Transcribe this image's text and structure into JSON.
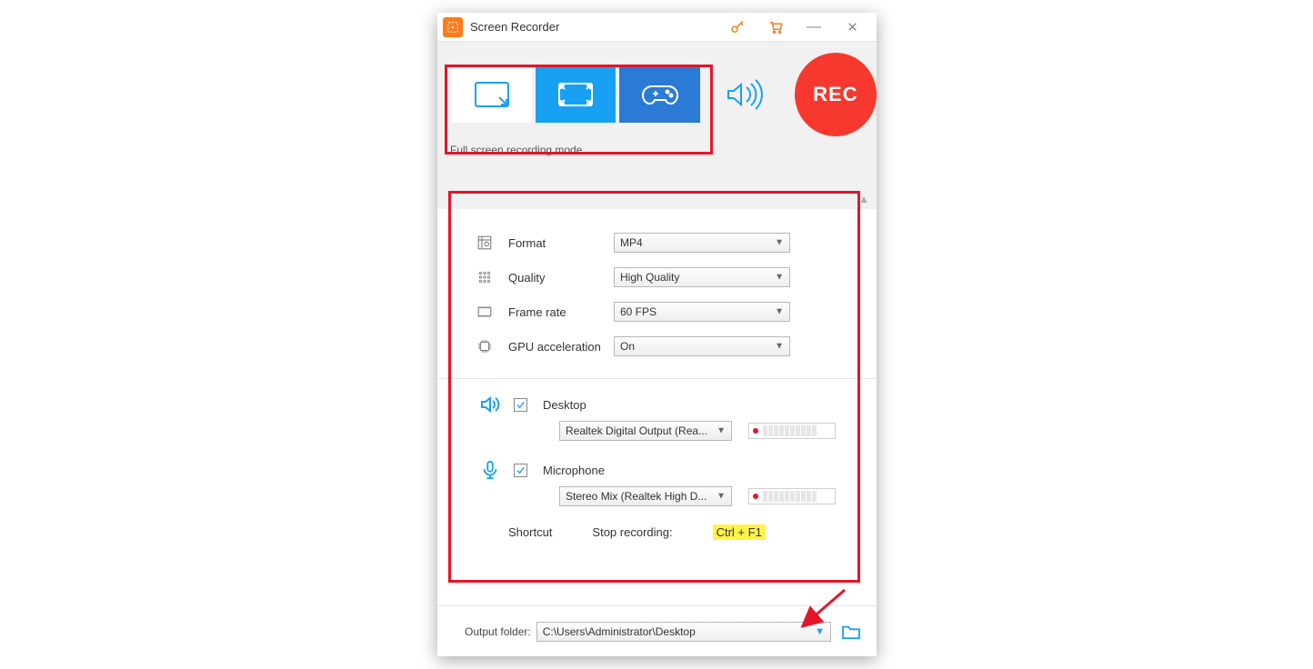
{
  "title": "Screen Recorder",
  "rec_label": "REC",
  "mode_desc": "Full screen recording mode.",
  "settings": {
    "format": {
      "label": "Format",
      "value": "MP4"
    },
    "quality": {
      "label": "Quality",
      "value": "High Quality"
    },
    "framerate": {
      "label": "Frame rate",
      "value": "60 FPS"
    },
    "gpu": {
      "label": "GPU acceleration",
      "value": "On"
    }
  },
  "audio": {
    "desktop": {
      "label": "Desktop",
      "device": "Realtek Digital Output (Rea..."
    },
    "mic": {
      "label": "Microphone",
      "device": "Stereo Mix (Realtek High D..."
    }
  },
  "shortcut": {
    "title": "Shortcut",
    "label": "Stop recording:",
    "key": "Ctrl + F1"
  },
  "footer": {
    "label": "Output folder:",
    "path": "C:\\Users\\Administrator\\Desktop"
  }
}
